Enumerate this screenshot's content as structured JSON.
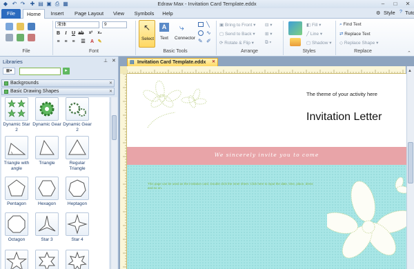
{
  "window": {
    "title": "Edraw Max - Invitation Card Template.eddx",
    "style_menu": "Style",
    "tutorial_menu": "Tutor"
  },
  "tabs": [
    {
      "label": "File"
    },
    {
      "label": "Home"
    },
    {
      "label": "Insert"
    },
    {
      "label": "Page Layout"
    },
    {
      "label": "View"
    },
    {
      "label": "Symbols"
    },
    {
      "label": "Help"
    }
  ],
  "ribbon": {
    "file_group": "File",
    "font_group": "Font",
    "font_name": "宋体",
    "font_size": "9",
    "basic_tools_group": "Basic Tools",
    "select_label": "Select",
    "text_label": "Text",
    "connector_label": "Connector",
    "arrange_group": "Arrange",
    "bring_to_front": "Bring to Front",
    "send_to_back": "Send to Back",
    "rotate_flip": "Rotate & Flip",
    "styles_group": "Styles",
    "fill_label": "Fill",
    "line_label": "Line",
    "shadow_label": "Shadow",
    "replace_group": "Replace",
    "find_text": "Find Text",
    "replace_text": "Replace Text",
    "replace_shape": "Replace Shape"
  },
  "libraries": {
    "header": "Libraries",
    "sections": [
      {
        "label": "Backgrounds"
      },
      {
        "label": "Basic Drawing Shapes"
      }
    ],
    "shapes": [
      {
        "label": "Dynamic Star 2"
      },
      {
        "label": "Dynamic Gear"
      },
      {
        "label": "Dynamic Gear 2"
      },
      {
        "label": "Triangle with angle"
      },
      {
        "label": "Triangle"
      },
      {
        "label": "Regular Triangle"
      },
      {
        "label": "Pentagon"
      },
      {
        "label": "Hexagon"
      },
      {
        "label": "Heptagon"
      },
      {
        "label": "Octagon"
      },
      {
        "label": "Star 3"
      },
      {
        "label": "Star 4"
      }
    ]
  },
  "document": {
    "tab_label": "Invitation Card Template.eddx",
    "theme_text": "The theme of your activity here",
    "title": "Invitation Letter",
    "band_text": "We sincerely invite you to come",
    "note_text": "This page can be used as the invitation card. Double click the inner sheet. Click here to input the date, time, place, dress and so on."
  },
  "colors": {
    "accent": "#2b6bbf",
    "band": "#e8a4a8",
    "teal": "#a8e6e6",
    "doc_tab": "#ffd862"
  }
}
